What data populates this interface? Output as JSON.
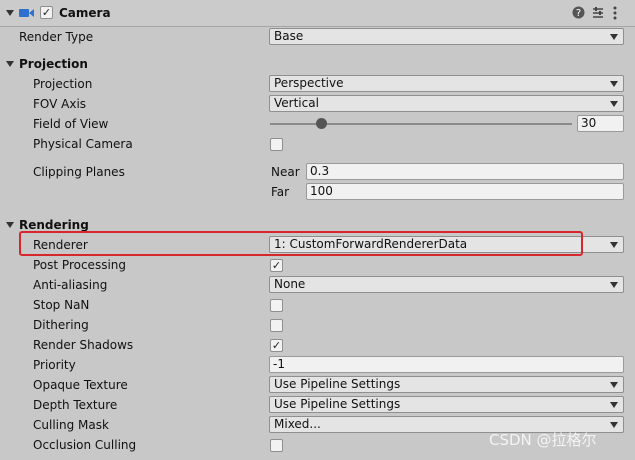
{
  "header": {
    "title": "Camera",
    "enabled": true,
    "help_icon": "help-icon",
    "presets_icon": "presets-icon",
    "menu_icon": "kebab-menu-icon"
  },
  "render_type": {
    "label": "Render Type",
    "value": "Base"
  },
  "projection_section": {
    "title": "Projection",
    "projection": {
      "label": "Projection",
      "value": "Perspective"
    },
    "fov_axis": {
      "label": "FOV Axis",
      "value": "Vertical"
    },
    "field_of_view": {
      "label": "Field of View",
      "value": "30",
      "slider_fraction": 0.17
    },
    "physical_camera": {
      "label": "Physical Camera",
      "checked": false
    },
    "clipping_planes": {
      "label": "Clipping Planes",
      "near_label": "Near",
      "near_value": "0.3",
      "far_label": "Far",
      "far_value": "100"
    }
  },
  "rendering_section": {
    "title": "Rendering",
    "renderer": {
      "label": "Renderer",
      "value": "1: CustomForwardRendererData"
    },
    "post_processing": {
      "label": "Post Processing",
      "checked": true
    },
    "anti_aliasing": {
      "label": "Anti-aliasing",
      "value": "None"
    },
    "stop_nan": {
      "label": "Stop NaN",
      "checked": false
    },
    "dithering": {
      "label": "Dithering",
      "checked": false
    },
    "render_shadows": {
      "label": "Render Shadows",
      "checked": true
    },
    "priority": {
      "label": "Priority",
      "value": "-1"
    },
    "opaque_texture": {
      "label": "Opaque Texture",
      "value": "Use Pipeline Settings"
    },
    "depth_texture": {
      "label": "Depth Texture",
      "value": "Use Pipeline Settings"
    },
    "culling_mask": {
      "label": "Culling Mask",
      "value": "Mixed..."
    },
    "occlusion_culling": {
      "label": "Occlusion Culling",
      "checked": false
    }
  },
  "watermark": "CSDN @拉格尔",
  "colors": {
    "highlight": "#d7262c",
    "camera_icon": "#2f6fce",
    "background": "#c8c8c8"
  }
}
